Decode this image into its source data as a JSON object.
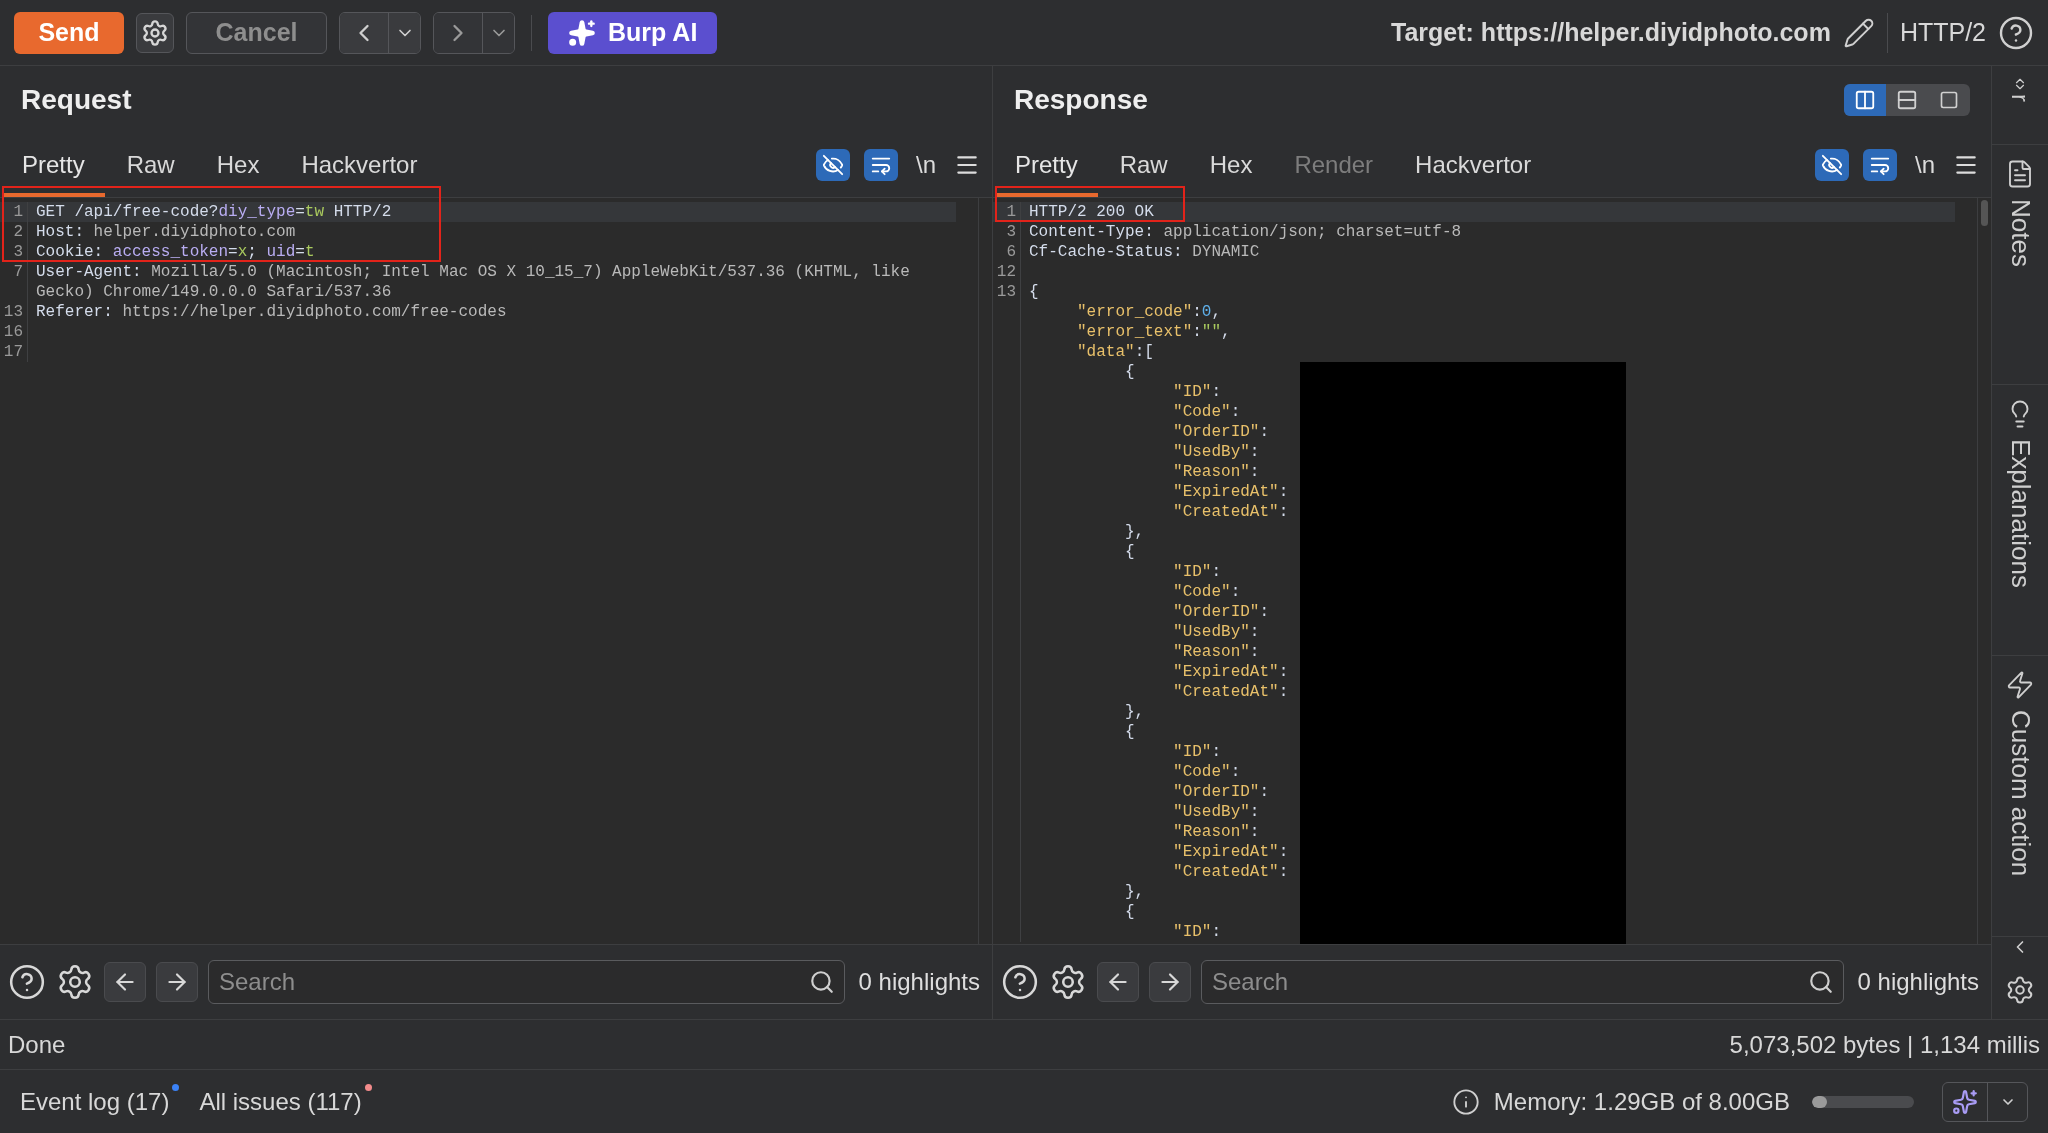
{
  "toolbar": {
    "send": "Send",
    "cancel": "Cancel",
    "burp_ai": "Burp AI",
    "target": "Target: https://helper.diyidphoto.com",
    "protocol": "HTTP/2"
  },
  "request": {
    "title": "Request",
    "tabs": [
      {
        "label": "Pretty",
        "selected": true,
        "disabled": false
      },
      {
        "label": "Raw",
        "selected": false,
        "disabled": false
      },
      {
        "label": "Hex",
        "selected": false,
        "disabled": false
      },
      {
        "label": "Hackvertor",
        "selected": false,
        "disabled": false
      }
    ],
    "toggles": [
      {
        "kind": "hide",
        "on": true
      },
      {
        "kind": "wrap",
        "on": true
      }
    ],
    "newline_toggle": "\\n",
    "lines": [
      {
        "number": "1",
        "current": true,
        "segments": [
          {
            "text": "GET /api/free-code?",
            "kind": "plain"
          },
          {
            "text": "diy_type",
            "kind": "param"
          },
          {
            "text": "=",
            "kind": "plain"
          },
          {
            "text": "tw",
            "kind": "param_value"
          },
          {
            "text": " HTTP/2",
            "kind": "plain"
          }
        ]
      },
      {
        "number": "2",
        "current": false,
        "segments": [
          {
            "text": "Host:",
            "kind": "plain"
          },
          {
            "text": " helper.diyidphoto.com",
            "kind": "value"
          }
        ]
      },
      {
        "number": "3",
        "current": false,
        "segments": [
          {
            "text": "Cookie: ",
            "kind": "plain"
          },
          {
            "text": "access_token",
            "kind": "param"
          },
          {
            "text": "=",
            "kind": "plain"
          },
          {
            "text": "x",
            "kind": "param_value"
          },
          {
            "text": "; ",
            "kind": "plain"
          },
          {
            "text": "uid",
            "kind": "param"
          },
          {
            "text": "=",
            "kind": "plain"
          },
          {
            "text": "t",
            "kind": "param_value"
          }
        ]
      },
      {
        "number": "7",
        "current": false,
        "segments": [
          {
            "text": "User-Agent:",
            "kind": "plain"
          },
          {
            "text": " Mozilla/5.0 (Macintosh; Intel Mac OS X 10_15_7) AppleWebKit/537.36 (KHTML, like Gecko) Chrome/149.0.0.0 Safari/537.36",
            "kind": "value"
          }
        ]
      },
      {
        "number": "13",
        "current": false,
        "segments": [
          {
            "text": "Referer:",
            "kind": "plain"
          },
          {
            "text": " https://helper.diyidphoto.com/free-codes",
            "kind": "value"
          }
        ]
      },
      {
        "number": "16",
        "current": false
      },
      {
        "number": "17",
        "current": false
      }
    ],
    "search": {
      "placeholder": "Search",
      "highlights": "0 highlights"
    }
  },
  "response": {
    "title": "Response",
    "layout_options": [
      {
        "kind": "columns",
        "selected": true
      },
      {
        "kind": "rows",
        "selected": false
      },
      {
        "kind": "single",
        "selected": false
      }
    ],
    "tabs": [
      {
        "label": "Pretty",
        "selected": true,
        "disabled": false
      },
      {
        "label": "Raw",
        "selected": false,
        "disabled": false
      },
      {
        "label": "Hex",
        "selected": false,
        "disabled": false
      },
      {
        "label": "Render",
        "selected": false,
        "disabled": true
      },
      {
        "label": "Hackvertor",
        "selected": false,
        "disabled": false
      }
    ],
    "toggles": [
      {
        "kind": "hide",
        "on": true
      },
      {
        "kind": "wrap",
        "on": true
      }
    ],
    "newline_toggle": "\\n",
    "lines": [
      {
        "number": "1",
        "current": true,
        "segments": [
          {
            "text": "HTTP/2 200 OK",
            "kind": "plain"
          }
        ]
      },
      {
        "number": "3",
        "current": false,
        "segments": [
          {
            "text": "Content-Type:",
            "kind": "plain"
          },
          {
            "text": " application/json; charset=utf-8",
            "kind": "value"
          }
        ]
      },
      {
        "number": "6",
        "current": false,
        "segments": [
          {
            "text": "Cf-Cache-Status:",
            "kind": "plain"
          },
          {
            "text": " DYNAMIC",
            "kind": "value"
          }
        ]
      },
      {
        "number": "12",
        "current": false
      },
      {
        "number": "13",
        "current": false,
        "segments": [
          {
            "text": "{",
            "kind": "plain"
          }
        ]
      },
      {
        "current": false,
        "segments": [
          {
            "text": "     \"error_code\"",
            "kind": "key"
          },
          {
            "text": ":",
            "kind": "plain"
          },
          {
            "text": "0",
            "kind": "number"
          },
          {
            "text": ",",
            "kind": "plain"
          }
        ]
      },
      {
        "current": false,
        "segments": [
          {
            "text": "     \"error_text\"",
            "kind": "key"
          },
          {
            "text": ":",
            "kind": "plain"
          },
          {
            "text": "\"\"",
            "kind": "string"
          },
          {
            "text": ",",
            "kind": "plain"
          }
        ]
      },
      {
        "current": false,
        "segments": [
          {
            "text": "     \"data\"",
            "kind": "key"
          },
          {
            "text": ":[",
            "kind": "plain"
          }
        ]
      },
      {
        "current": false,
        "segments": [
          {
            "text": "          {",
            "kind": "plain"
          }
        ]
      },
      {
        "current": false,
        "segments": [
          {
            "text": "               \"ID\"",
            "kind": "key"
          },
          {
            "text": ":",
            "kind": "plain"
          }
        ]
      },
      {
        "current": false,
        "segments": [
          {
            "text": "               \"Code\"",
            "kind": "key"
          },
          {
            "text": ":",
            "kind": "plain"
          }
        ]
      },
      {
        "current": false,
        "segments": [
          {
            "text": "               \"OrderID\"",
            "kind": "key"
          },
          {
            "text": ":",
            "kind": "plain"
          }
        ]
      },
      {
        "current": false,
        "segments": [
          {
            "text": "               \"UsedBy\"",
            "kind": "key"
          },
          {
            "text": ":",
            "kind": "plain"
          }
        ]
      },
      {
        "current": false,
        "segments": [
          {
            "text": "               \"Reason\"",
            "kind": "key"
          },
          {
            "text": ":",
            "kind": "plain"
          }
        ]
      },
      {
        "current": false,
        "segments": [
          {
            "text": "               \"ExpiredAt\"",
            "kind": "key"
          },
          {
            "text": ":",
            "kind": "plain"
          }
        ]
      },
      {
        "current": false,
        "segments": [
          {
            "text": "               \"CreatedAt\"",
            "kind": "key"
          },
          {
            "text": ":",
            "kind": "plain"
          }
        ]
      },
      {
        "current": false,
        "segments": [
          {
            "text": "          },",
            "kind": "plain"
          }
        ]
      },
      {
        "current": false,
        "segments": [
          {
            "text": "          {",
            "kind": "plain"
          }
        ]
      },
      {
        "current": false,
        "segments": [
          {
            "text": "               \"ID\"",
            "kind": "key"
          },
          {
            "text": ":",
            "kind": "plain"
          }
        ]
      },
      {
        "current": false,
        "segments": [
          {
            "text": "               \"Code\"",
            "kind": "key"
          },
          {
            "text": ":",
            "kind": "plain"
          }
        ]
      },
      {
        "current": false,
        "segments": [
          {
            "text": "               \"OrderID\"",
            "kind": "key"
          },
          {
            "text": ":",
            "kind": "plain"
          }
        ]
      },
      {
        "current": false,
        "segments": [
          {
            "text": "               \"UsedBy\"",
            "kind": "key"
          },
          {
            "text": ":",
            "kind": "plain"
          }
        ]
      },
      {
        "current": false,
        "segments": [
          {
            "text": "               \"Reason\"",
            "kind": "key"
          },
          {
            "text": ":",
            "kind": "plain"
          }
        ]
      },
      {
        "current": false,
        "segments": [
          {
            "text": "               \"ExpiredAt\"",
            "kind": "key"
          },
          {
            "text": ":",
            "kind": "plain"
          }
        ]
      },
      {
        "current": false,
        "segments": [
          {
            "text": "               \"CreatedAt\"",
            "kind": "key"
          },
          {
            "text": ":",
            "kind": "plain"
          }
        ]
      },
      {
        "current": false,
        "segments": [
          {
            "text": "          },",
            "kind": "plain"
          }
        ]
      },
      {
        "current": false,
        "segments": [
          {
            "text": "          {",
            "kind": "plain"
          }
        ]
      },
      {
        "current": false,
        "segments": [
          {
            "text": "               \"ID\"",
            "kind": "key"
          },
          {
            "text": ":",
            "kind": "plain"
          }
        ]
      },
      {
        "current": false,
        "segments": [
          {
            "text": "               \"Code\"",
            "kind": "key"
          },
          {
            "text": ":",
            "kind": "plain"
          }
        ]
      },
      {
        "current": false,
        "segments": [
          {
            "text": "               \"OrderID\"",
            "kind": "key"
          },
          {
            "text": ":",
            "kind": "plain"
          }
        ]
      },
      {
        "current": false,
        "segments": [
          {
            "text": "               \"UsedBy\"",
            "kind": "key"
          },
          {
            "text": ":",
            "kind": "plain"
          }
        ]
      },
      {
        "current": false,
        "segments": [
          {
            "text": "               \"Reason\"",
            "kind": "key"
          },
          {
            "text": ":",
            "kind": "plain"
          }
        ]
      },
      {
        "current": false,
        "segments": [
          {
            "text": "               \"ExpiredAt\"",
            "kind": "key"
          },
          {
            "text": ":",
            "kind": "plain"
          }
        ]
      },
      {
        "current": false,
        "segments": [
          {
            "text": "               \"CreatedAt\"",
            "kind": "key"
          },
          {
            "text": ":",
            "kind": "plain"
          }
        ]
      },
      {
        "current": false,
        "segments": [
          {
            "text": "          },",
            "kind": "plain"
          }
        ]
      },
      {
        "current": false,
        "segments": [
          {
            "text": "          {",
            "kind": "plain"
          }
        ]
      },
      {
        "current": false,
        "segments": [
          {
            "text": "               \"ID\"",
            "kind": "key"
          },
          {
            "text": ":",
            "kind": "plain"
          }
        ]
      }
    ],
    "search": {
      "placeholder": "Search",
      "highlights": "0 highlights"
    }
  },
  "sidebar": {
    "cut_label": "r",
    "items": [
      {
        "label": "Notes",
        "kind": "notes"
      },
      {
        "label": "Explanations",
        "kind": "explanations"
      },
      {
        "label": "Custom action",
        "kind": "custom"
      }
    ]
  },
  "status": {
    "message": "Done",
    "stats": "5,073,502 bytes | 1,134 millis"
  },
  "bottom_bar": {
    "event_log": {
      "label": "Event log (17)",
      "color": "#3b82f6"
    },
    "issues": {
      "label": "All issues (117)",
      "color": "#f28b8b"
    },
    "memory": {
      "label": "Memory: 1.29GB of 8.00GB",
      "level": 0.15
    }
  }
}
